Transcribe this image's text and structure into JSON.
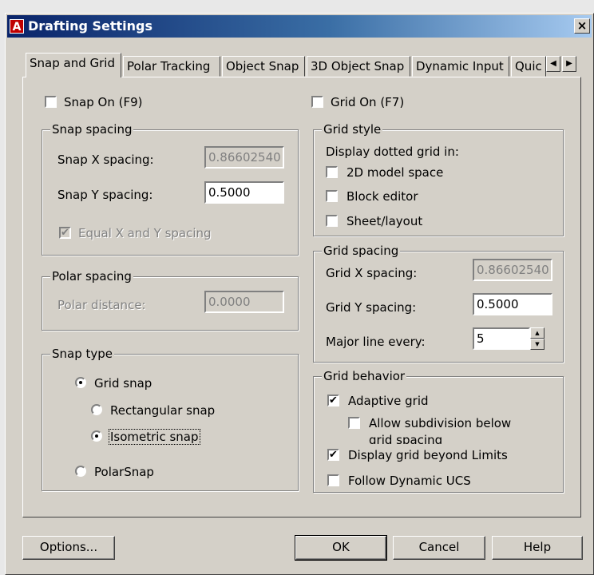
{
  "window": {
    "title": "Drafting Settings",
    "close": "×",
    "app_icon": "A"
  },
  "tabs": [
    "Snap and Grid",
    "Polar Tracking",
    "Object Snap",
    "3D Object Snap",
    "Dynamic Input",
    "Quic"
  ],
  "tab_scroll": {
    "left": "◀",
    "right": "▶"
  },
  "snap_on": {
    "label": "Snap On (F9)",
    "checked": ""
  },
  "grid_on": {
    "label": "Grid On (F7)",
    "checked": ""
  },
  "snap_spacing": {
    "title": "Snap spacing",
    "x_label": "Snap X spacing:",
    "x_value": "0.86602540",
    "y_label": "Snap Y spacing:",
    "y_value": "0.5000",
    "equal_label": "Equal X and Y spacing",
    "equal_check": "✔"
  },
  "polar_spacing": {
    "title": "Polar spacing",
    "distance_label": "Polar distance:",
    "distance_value": "0.0000"
  },
  "snap_type": {
    "title": "Snap type",
    "grid_snap": "Grid snap",
    "rectangular": "Rectangular snap",
    "isometric": "Isometric snap",
    "polarsnap": "PolarSnap"
  },
  "grid_style": {
    "title": "Grid style",
    "display_label": "Display dotted grid in:",
    "model": "2D model space",
    "block": "Block editor",
    "sheet": "Sheet/layout"
  },
  "grid_spacing": {
    "title": "Grid spacing",
    "x_label": "Grid X spacing:",
    "x_value": "0.86602540",
    "y_label": "Grid Y spacing:",
    "y_value": "0.5000",
    "major_label": "Major line every:",
    "major_value": "5"
  },
  "grid_behavior": {
    "title": "Grid behavior",
    "adaptive": "Adaptive grid",
    "subdivision_line1": "Allow subdivision below",
    "subdivision_line2": "grid spacing",
    "beyond": "Display grid beyond Limits",
    "dynamic_ucs": "Follow Dynamic UCS",
    "check": "✔"
  },
  "buttons": {
    "options": "Options...",
    "ok": "OK",
    "cancel": "Cancel",
    "help": "Help"
  }
}
